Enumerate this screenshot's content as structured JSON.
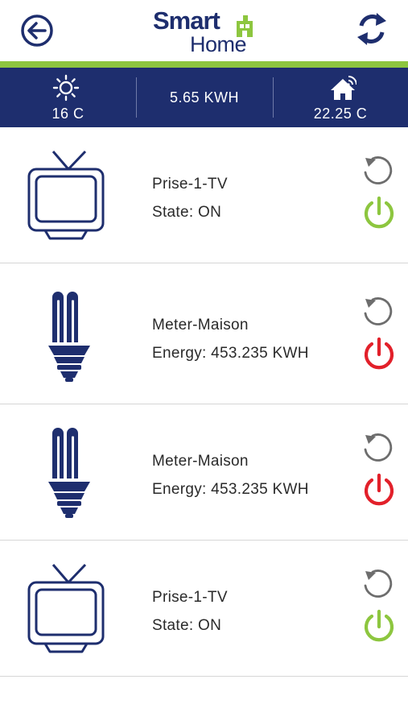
{
  "header": {
    "logo_line1": "Smart",
    "logo_line2": "Home",
    "back_icon": "back-arrow-icon",
    "refresh_icon": "refresh-icon"
  },
  "stats": {
    "temperature_outside": "16 C",
    "energy_total": "5.65 KWH",
    "temperature_home": "22.25 C"
  },
  "devices": [
    {
      "icon": "tv-icon",
      "name": "Prise-1-TV",
      "status": "State: ON",
      "power": "on"
    },
    {
      "icon": "bulb-icon",
      "name": "Meter-Maison",
      "status": "Energy: 453.235 KWH",
      "power": "off"
    },
    {
      "icon": "bulb-icon",
      "name": "Meter-Maison",
      "status": "Energy: 453.235 KWH",
      "power": "off"
    },
    {
      "icon": "tv-icon",
      "name": "Prise-1-TV",
      "status": "State: ON",
      "power": "on"
    }
  ],
  "colors": {
    "navy": "#1e2e6e",
    "green": "#8dc63f",
    "red": "#e2202a",
    "grey": "#6d6d6d"
  }
}
